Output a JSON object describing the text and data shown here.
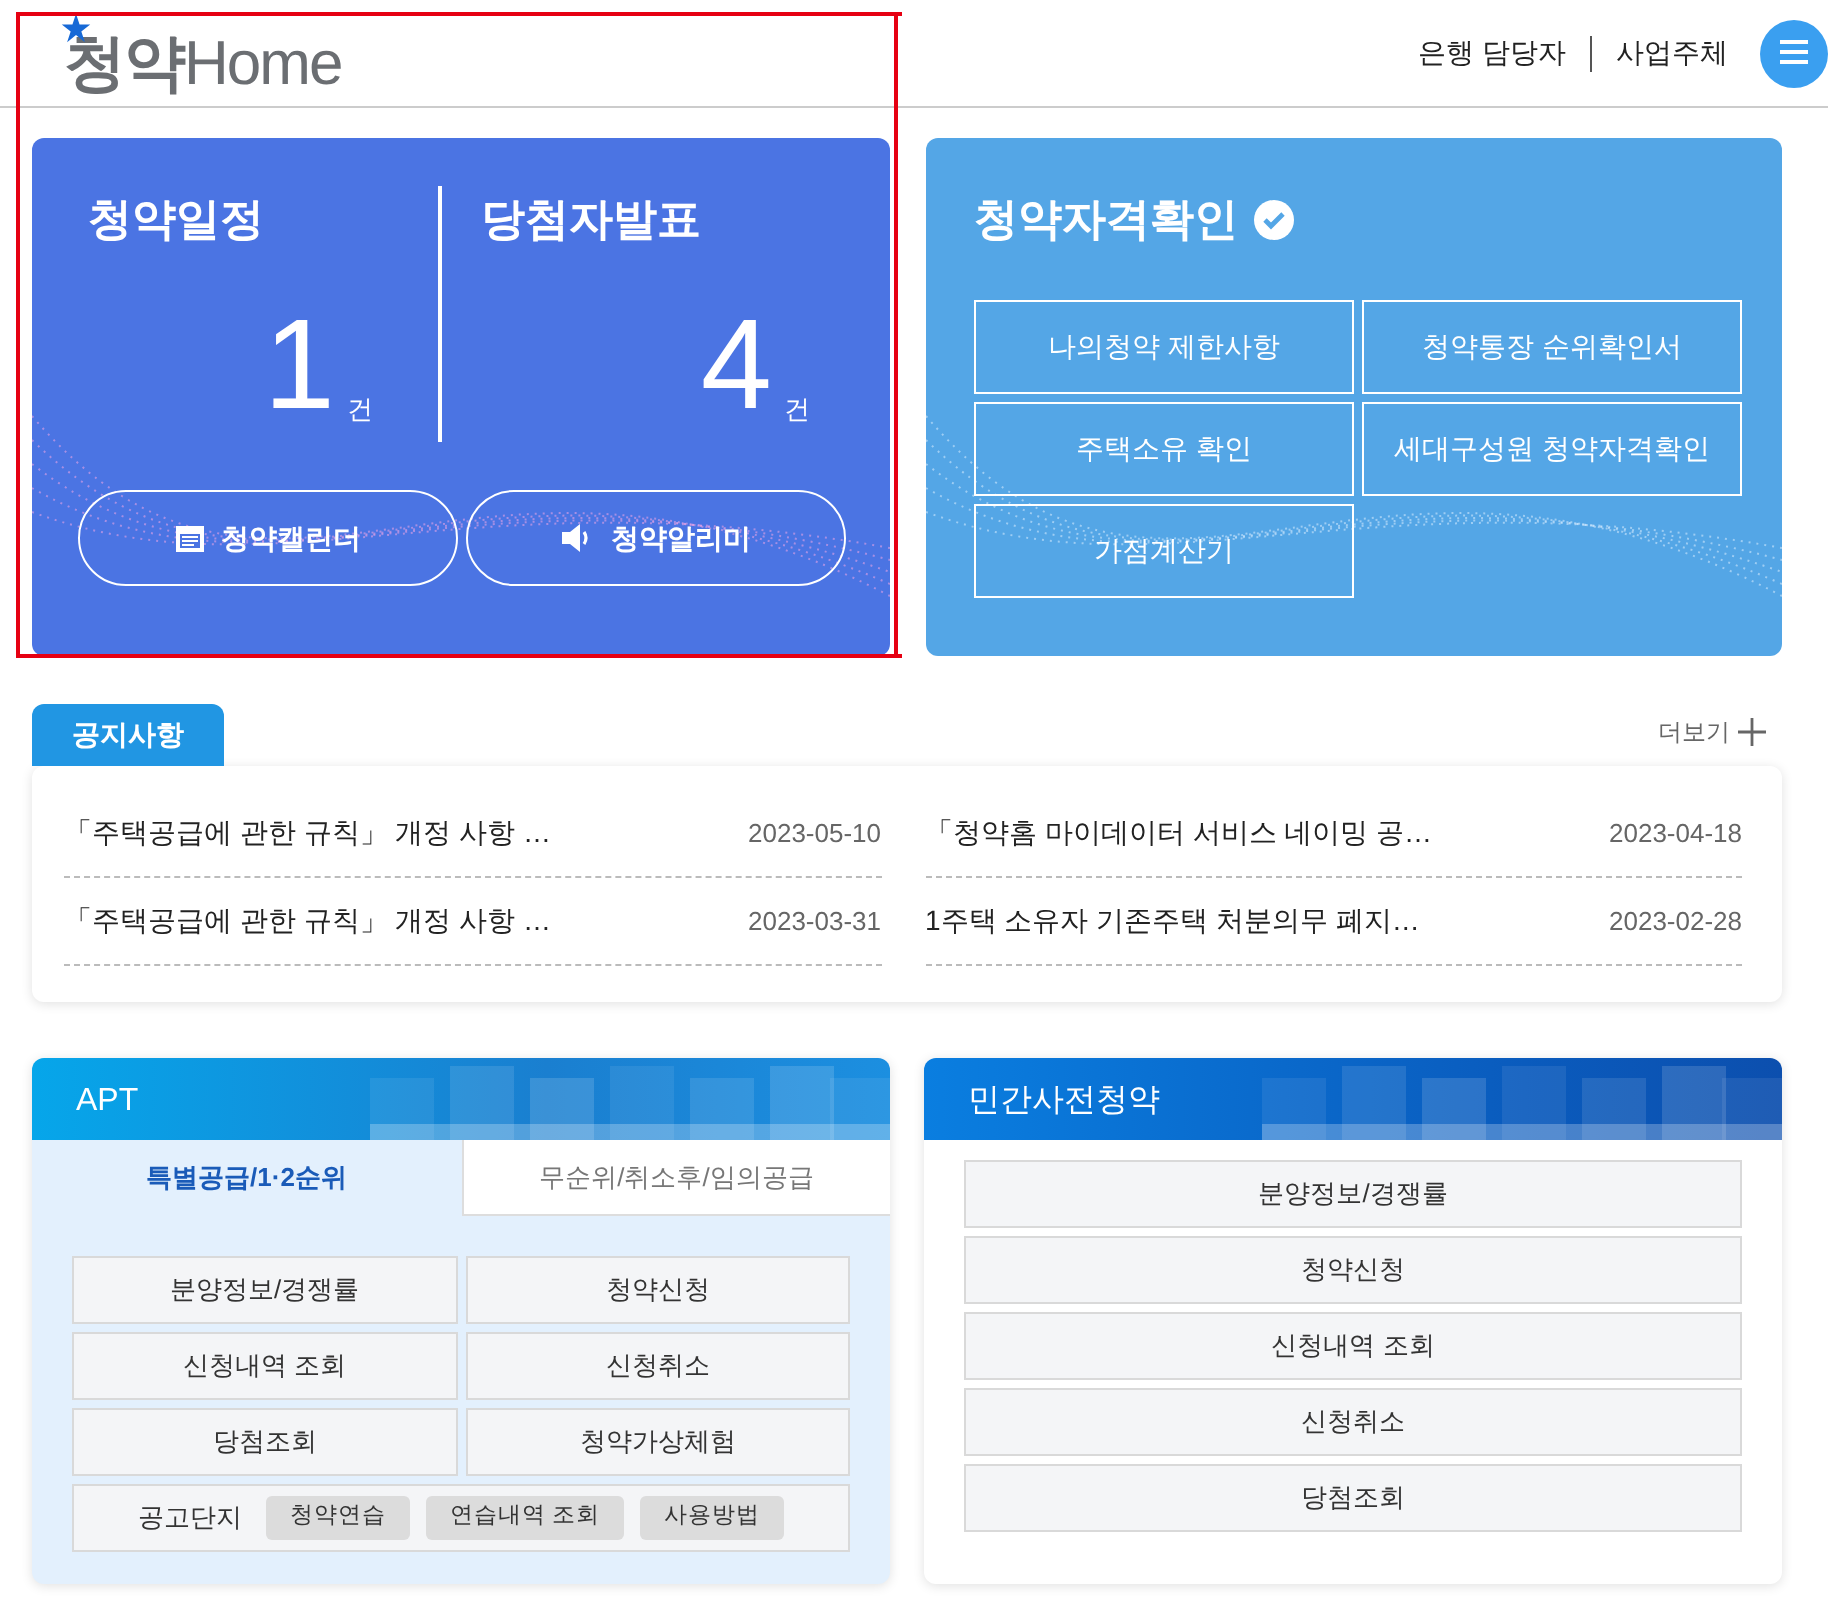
{
  "header": {
    "logo": {
      "korean": "청약",
      "latin": "Home"
    },
    "links": [
      "은행 담당자",
      "사업주체"
    ]
  },
  "summary": {
    "stats": [
      {
        "title": "청약일정",
        "count": "1",
        "unit": "건"
      },
      {
        "title": "당첨자발표",
        "count": "4",
        "unit": "건"
      }
    ],
    "buttons": [
      {
        "label": "청약캘린더",
        "kind": "calendar"
      },
      {
        "label": "청약알리미",
        "kind": "speaker"
      }
    ]
  },
  "eligibility": {
    "title": "청약자격확인",
    "links": [
      "나의청약 제한사항",
      "청약통장 순위확인서",
      "주택소유 확인",
      "세대구성원 청약자격확인",
      "가점계산기"
    ]
  },
  "notices": {
    "tab": "공지사항",
    "more": "더보기",
    "items": [
      {
        "title": "「주택공급에 관한 규칙」 개정 사항 …",
        "date": "2023-05-10"
      },
      {
        "title": "「청약홈 마이데이터 서비스 네이밍 공…",
        "date": "2023-04-18"
      },
      {
        "title": "「주택공급에 관한 규칙」 개정 사항 …",
        "date": "2023-03-31"
      },
      {
        "title": "1주택 소유자 기존주택 처분의무 폐지…",
        "date": "2023-02-28"
      }
    ]
  },
  "apt": {
    "title": "APT",
    "tabs": [
      {
        "label": "특별공급/1·2순위",
        "selected": true
      },
      {
        "label": "무순위/취소후/임의공급",
        "selected": false
      }
    ],
    "buttons": [
      "분양정보/경쟁률",
      "청약신청",
      "신청내역 조회",
      "신청취소",
      "당첨조회",
      "청약가상체험"
    ],
    "extra": {
      "label": "공고단지",
      "buttons": [
        "청약연습",
        "연습내역 조회",
        "사용방법"
      ]
    }
  },
  "private": {
    "title": "민간사전청약",
    "buttons": [
      "분양정보/경쟁률",
      "청약신청",
      "신청내역 조회",
      "신청취소",
      "당첨조회"
    ]
  }
}
